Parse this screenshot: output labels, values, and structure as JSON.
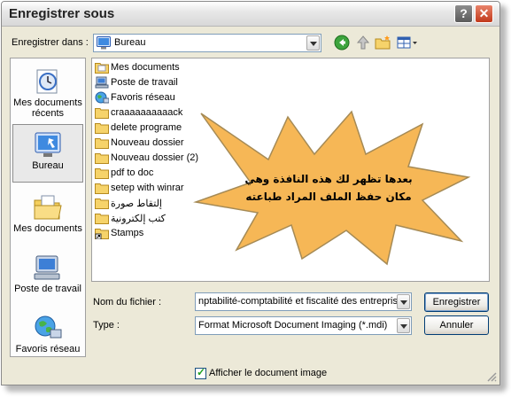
{
  "window": {
    "title": "Enregistrer sous"
  },
  "save_in": {
    "label": "Enregistrer dans :",
    "value": "Bureau"
  },
  "places": [
    {
      "label": "Mes documents récents",
      "icon": "recent-documents-icon"
    },
    {
      "label": "Bureau",
      "icon": "desktop-icon",
      "selected": true
    },
    {
      "label": "Mes documents",
      "icon": "my-documents-icon"
    },
    {
      "label": "Poste de travail",
      "icon": "my-computer-icon"
    },
    {
      "label": "Favoris réseau",
      "icon": "network-places-icon"
    }
  ],
  "files": [
    {
      "name": "Mes documents",
      "icon": "folder-icon"
    },
    {
      "name": "Poste de travail",
      "icon": "computer-icon"
    },
    {
      "name": "Favoris réseau",
      "icon": "network-icon"
    },
    {
      "name": "craaaaaaaaaack",
      "icon": "folder-icon"
    },
    {
      "name": "delete programe",
      "icon": "folder-icon"
    },
    {
      "name": "Nouveau dossier",
      "icon": "folder-icon"
    },
    {
      "name": "Nouveau dossier (2)",
      "icon": "folder-icon"
    },
    {
      "name": "pdf to doc",
      "icon": "folder-icon"
    },
    {
      "name": "setep with winrar",
      "icon": "folder-icon"
    },
    {
      "name": "إلتقاط صورة",
      "icon": "folder-icon"
    },
    {
      "name": "كتب إلكترونية",
      "icon": "folder-icon"
    },
    {
      "name": "Stamps",
      "icon": "shortcut-folder-icon"
    }
  ],
  "callout": {
    "line1": "بعدها تظهر لك هذه النافذة وهي",
    "line2": "مكان حفظ الملف المراد طباعته"
  },
  "filename": {
    "label": "Nom du fichier :",
    "value": "nptabilité-comptabilité et fiscalité des entreprises"
  },
  "filetype": {
    "label": "Type :",
    "value": "Format Microsoft Document Imaging (*.mdi)"
  },
  "buttons": {
    "save": "Enregistrer",
    "cancel": "Annuler"
  },
  "show_document": {
    "label": "Afficher le document image",
    "checked": true
  },
  "colors": {
    "accent": "#003c74",
    "close": "#c1391b",
    "callout": "#f6b756"
  }
}
